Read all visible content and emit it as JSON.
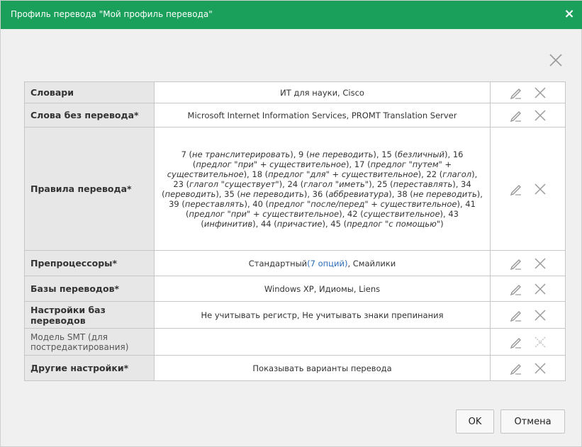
{
  "dialog": {
    "title": "Профиль перевода \"Мой профиль перевода\"",
    "close_glyph": "×"
  },
  "rows": [
    {
      "label": "Словари",
      "value": "ИТ для науки, Cisco"
    },
    {
      "label": "Слова без перевода*",
      "value": "Microsoft Internet Information Services, PROMT Translation Server"
    },
    {
      "label": "Правила перевода*",
      "rules": [
        {
          "n": "7",
          "t": "не транслитерировать"
        },
        {
          "n": "9",
          "t": "не переводить"
        },
        {
          "n": "15",
          "t": "безличный"
        },
        {
          "n": "16",
          "t": "предлог \"при\" + существительное"
        },
        {
          "n": "17",
          "t": "предлог \"путем\" + существительное"
        },
        {
          "n": "18",
          "t": "предлог \"для\" + существительное"
        },
        {
          "n": "22",
          "t": "глагол"
        },
        {
          "n": "23",
          "t": "глагол \"существует\""
        },
        {
          "n": "24",
          "t": "глагол \"иметь\""
        },
        {
          "n": "25",
          "t": "переставлять"
        },
        {
          "n": "34",
          "t": "переводить"
        },
        {
          "n": "35",
          "t": "не переводить"
        },
        {
          "n": "36",
          "t": "аббревиатура"
        },
        {
          "n": "38",
          "t": "не переводить"
        },
        {
          "n": "39",
          "t": "переставлять"
        },
        {
          "n": "40",
          "t": "предлог \"после/перед\" + существительное"
        },
        {
          "n": "41",
          "t": "предлог \"при\" + существительное"
        },
        {
          "n": "42",
          "t": "существительное"
        },
        {
          "n": "43",
          "t": "инфинитив"
        },
        {
          "n": "44",
          "t": "причастие"
        },
        {
          "n": "45",
          "t": "предлог \"с помощью\""
        }
      ]
    },
    {
      "label": "Препроцессоры*",
      "value_prefix": "Стандартный",
      "value_link": "(7 опций)",
      "value_suffix": ", Смайлики"
    },
    {
      "label": "Базы переводов*",
      "value": "Windows XP, Идиомы, Liens"
    },
    {
      "label": "Настройки баз переводов",
      "value": "Не учитывать регистр, Не учитывать знаки препинания"
    },
    {
      "label": "Модель SMT (для постредактирования)",
      "value": ""
    },
    {
      "label": "Другие настройки*",
      "value": "Показывать варианты перевода"
    }
  ],
  "buttons": {
    "ok": "OK",
    "cancel": "Отмена"
  },
  "icons": {
    "edit": "pencil-icon",
    "delete": "close-icon"
  },
  "colors": {
    "title_bar": "#1aa05a",
    "link": "#2a6ab8",
    "label_bg": "#e7e7e7"
  }
}
